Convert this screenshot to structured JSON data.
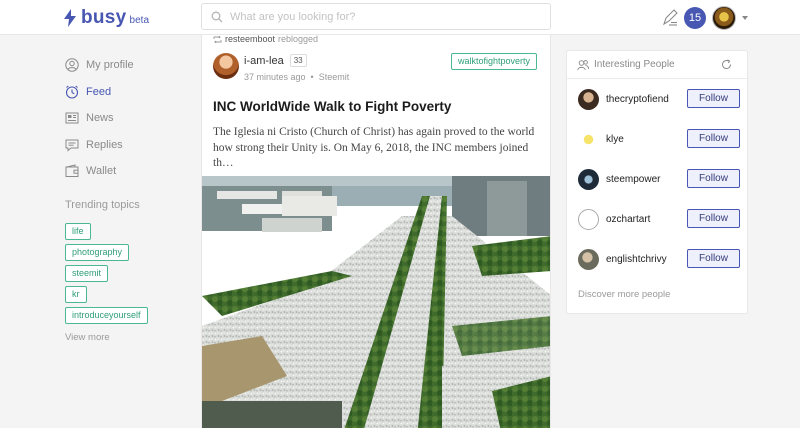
{
  "brand": {
    "name": "busy",
    "badge": "beta",
    "color": "#4757b2"
  },
  "search": {
    "placeholder": "What are you looking for?"
  },
  "header": {
    "notification_count": "15"
  },
  "sidebar": {
    "items": [
      {
        "label": "My profile",
        "icon": "user-circle-icon",
        "active": false
      },
      {
        "label": "Feed",
        "icon": "clock-icon",
        "active": true
      },
      {
        "label": "News",
        "icon": "news-icon",
        "active": false
      },
      {
        "label": "Replies",
        "icon": "chat-icon",
        "active": false
      },
      {
        "label": "Wallet",
        "icon": "wallet-icon",
        "active": false
      }
    ],
    "trending_title": "Trending topics",
    "topics": [
      "life",
      "photography",
      "steemit",
      "kr",
      "introduceyourself"
    ],
    "view_more": "View more"
  },
  "post": {
    "reblogged_by": "resteemboot",
    "reblog_text": "reblogged",
    "author": "i-am-lea",
    "reputation": "33",
    "time": "37 minutes ago",
    "app": "Steemit",
    "tag": "walktofightpoverty",
    "title": "INC WorldWide Walk to Fight Poverty",
    "excerpt": "The Iglesia ni Cristo (Church of Christ) has again proved to the world how strong their Unity is. On May 6, 2018, the INC members joined th…"
  },
  "people": {
    "title": "Interesting People",
    "follow_label": "Follow",
    "list": [
      {
        "name": "thecryptofiend"
      },
      {
        "name": "klye"
      },
      {
        "name": "steempower"
      },
      {
        "name": "ozchartart"
      },
      {
        "name": "englishtchrivy"
      }
    ],
    "discover": "Discover more people"
  }
}
